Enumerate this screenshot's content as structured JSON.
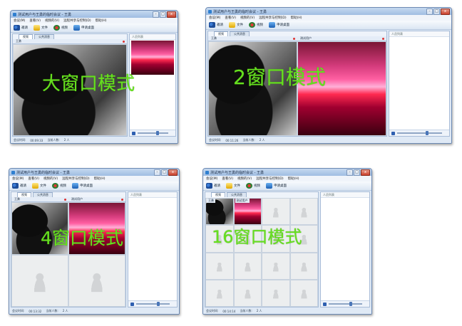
{
  "common": {
    "window_title": "测试用户与王勇的临时会议 - 王勇",
    "menu": [
      "会议(M)",
      "查看(V)",
      "视频的(V)",
      "远程共享与控制(D)",
      "帮助(H)"
    ],
    "toolbar": [
      "邀请",
      "文件",
      "视频",
      "申请桌面"
    ],
    "tabs": [
      "视频",
      "公共消息"
    ],
    "users_header": "人员列表",
    "status_time_label": "会议时间:",
    "status_count_label": "当前人数:"
  },
  "windows": [
    {
      "mode_label": "大窗口模式",
      "video_headers": [
        "王勇"
      ],
      "time": "00:09:33",
      "count": "2 人"
    },
    {
      "mode_label": "2窗口模式",
      "video_headers": [
        "王勇",
        "测试用户"
      ],
      "time": "00:11:26",
      "count": "2 人"
    },
    {
      "mode_label": "4窗口模式",
      "video_headers": [
        "王勇",
        "测试用户"
      ],
      "time": "00:13:32",
      "count": "2 人"
    },
    {
      "mode_label": "16窗口模式",
      "video_headers": [
        "王勇",
        "测试用户"
      ],
      "time": "00:14:14",
      "count": "2 人"
    }
  ]
}
